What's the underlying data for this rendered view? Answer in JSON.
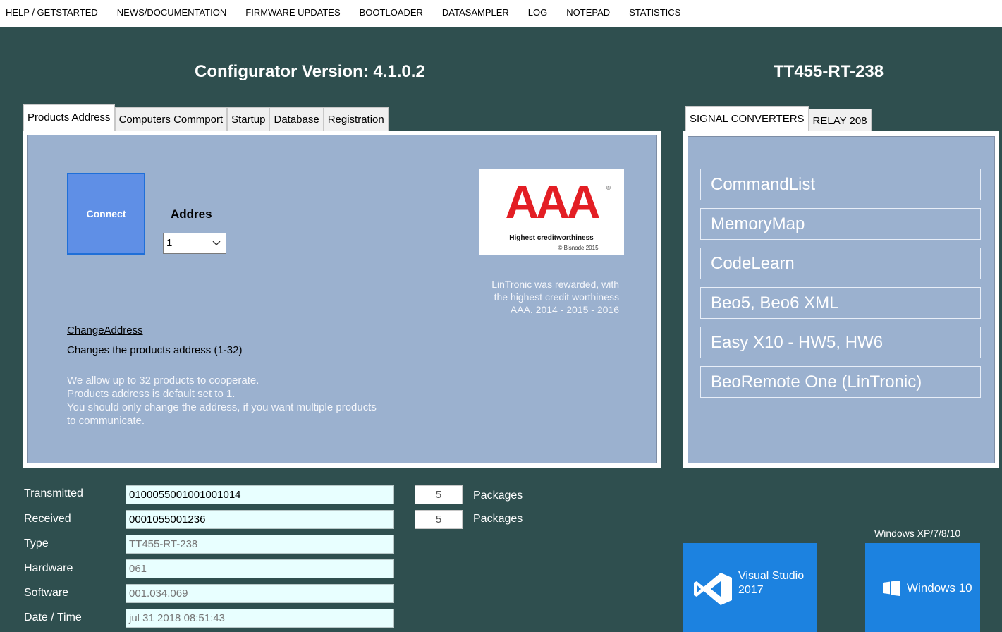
{
  "menu": [
    "HELP / GETSTARTED",
    "NEWS/DOCUMENTATION",
    "FIRMWARE UPDATES",
    "BOOTLOADER",
    "DATASAMPLER",
    "LOG",
    "NOTEPAD",
    "STATISTICS"
  ],
  "header": {
    "config_title": "Configurator Version: 4.1.0.2",
    "device_title": "TT455-RT-238"
  },
  "left_tabs": [
    "Products Address",
    "Computers Commport",
    "Startup",
    "Database",
    "Registration"
  ],
  "right_tabs": [
    "SIGNAL CONVERTERS",
    "RELAY 208"
  ],
  "address_panel": {
    "connect_label": "Connect",
    "address_label": "Addres",
    "address_value": "1",
    "change_link": "ChangeAddress",
    "change_desc": "Changes the products address (1-32)",
    "info": [
      "We allow up to 32 products to cooperate.",
      "Products address is default set to 1.",
      "You should only change the address, if you want multiple products",
      "to communicate."
    ]
  },
  "aaa": {
    "badge_text": "AAA",
    "badge_caption": "Highest creditworthiness",
    "badge_copyright": "© Bisnode 2015",
    "reward_lines": [
      "LinTronic was rewarded, with",
      "the highest credit worthiness",
      "AAA. 2014 - 2015 - 2016"
    ]
  },
  "signal_converters": [
    "CommandList",
    "MemoryMap",
    "CodeLearn",
    "Beo5, Beo6 XML",
    "Easy X10 - HW5, HW6",
    "BeoRemote One (LinTronic)"
  ],
  "fields": {
    "transmitted_label": "Transmitted",
    "transmitted_value": "0100055001001001014",
    "transmitted_packages": "5",
    "received_label": "Received",
    "received_value": "0001055001236",
    "received_packages": "5",
    "packages_label": "Packages",
    "type_label": "Type",
    "type_value": "TT455-RT-238",
    "hardware_label": "Hardware",
    "hardware_value": "061",
    "software_label": "Software",
    "software_value": "001.034.069",
    "datetime_label": "Date / Time",
    "datetime_value": "jul 31 2018 08:51:43"
  },
  "tiles": {
    "vs_line1": "Visual Studio",
    "vs_line2": "2017",
    "windows_caption": "Windows XP/7/8/10",
    "windows_label": "Windows 10"
  },
  "colors": {
    "background": "#2f4f4f",
    "panel": "#9bb1cf",
    "connect": "#5f8fe6",
    "tile": "#1c82e0",
    "aaa_red": "#e31e24"
  }
}
